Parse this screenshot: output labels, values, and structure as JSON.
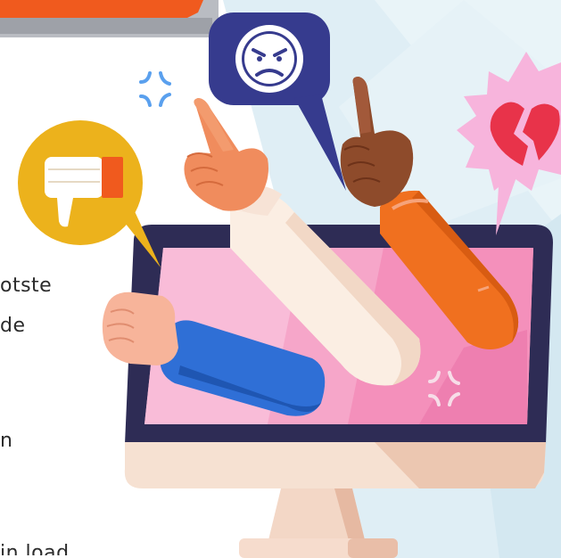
{
  "text_fragments": {
    "line1": "otste",
    "line2": "de",
    "line3": "n",
    "line4": "in load"
  },
  "icons": {
    "thumbs_down": "thumbs-down-icon",
    "angry_face": "angry-face-icon",
    "broken_heart": "broken-heart-icon",
    "anger_symbol": "anger-symbol-icon"
  },
  "colors": {
    "monitor_frame": "#2e2c55",
    "screen_pink": "#f6a6c9",
    "orange_banner": "#f05a1e",
    "thumbs_bubble": "#ecb21c",
    "angry_bubble": "#363b8e",
    "heart_burst": "#f7b4dc",
    "heart_red": "#e8334a"
  }
}
